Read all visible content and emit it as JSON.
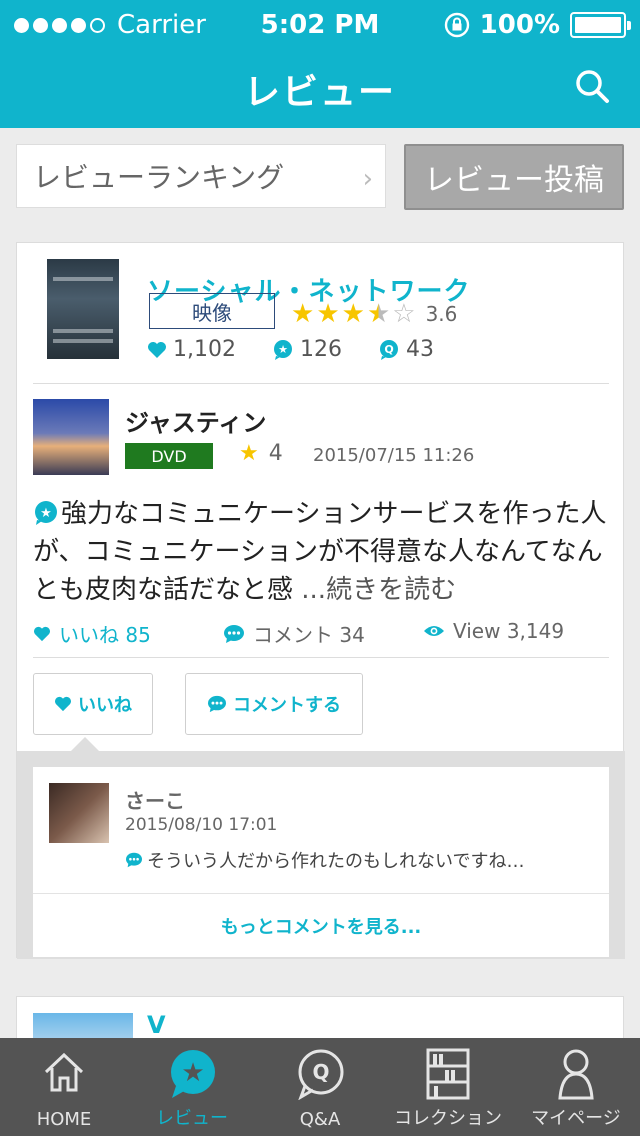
{
  "status_bar": {
    "carrier": "Carrier",
    "time": "5:02 PM",
    "battery": "100%",
    "signal_bars_filled": 4,
    "signal_bars_total": 5
  },
  "nav": {
    "title": "レビュー",
    "search_icon": "search-icon"
  },
  "actions": {
    "ranking_label": "レビューランキング",
    "post_label": "レビュー投稿"
  },
  "review_card": {
    "work": {
      "title": "ソーシャル・ネットワーク",
      "media": "映像",
      "rating": "3.6",
      "rating_value": 3.6,
      "likes": "1,102",
      "reviews": "126",
      "questions": "43"
    },
    "reviewer": {
      "name": "ジャスティン",
      "format": "DVD",
      "rating": "4",
      "date": "2015/07/15 11:26"
    },
    "text": "強力なコミュニケーションサービスを作った人が、コミュニケーションが不得意な人なんてなんとも皮肉な話だなと感",
    "read_more": "...続きを読む",
    "stats": {
      "like_label": "いいね 85",
      "comment_label": "コメント 34",
      "view_label": "View 3,149"
    },
    "buttons": {
      "like": "いいね",
      "comment": "コメントする"
    },
    "comment": {
      "name": "さーこ",
      "date": "2015/08/10 17:01",
      "text": "そういう人だから作れたのもしれないですね…"
    },
    "more_comments": "もっとコメントを見る..."
  },
  "next_card": {
    "title": "V"
  },
  "tabs": [
    {
      "label": "HOME",
      "icon": "home-icon",
      "active": false
    },
    {
      "label": "レビュー",
      "icon": "review-star-icon",
      "active": true
    },
    {
      "label": "Q&A",
      "icon": "qa-icon",
      "active": false
    },
    {
      "label": "コレクション",
      "icon": "bookshelf-icon",
      "active": false
    },
    {
      "label": "マイページ",
      "icon": "person-icon",
      "active": false
    }
  ],
  "colors": {
    "accent": "#10b4cc",
    "tabbar": "#545454",
    "dvd_tag": "#1f7a1f",
    "star": "#f7c500"
  }
}
